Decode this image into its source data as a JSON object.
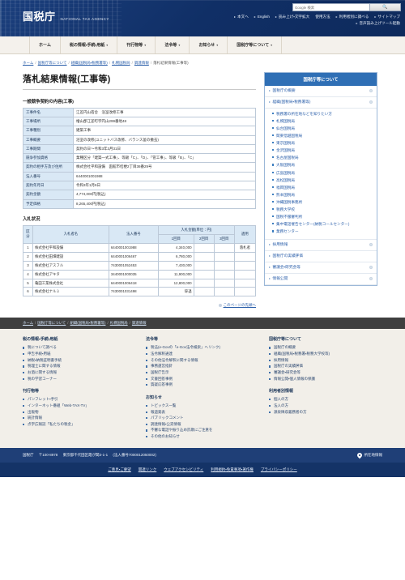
{
  "header": {
    "logo_jp": "国税庁",
    "logo_en": "NATIONAL TAX AGENCY",
    "search_placeholder": "Google 検索",
    "search_button_icon": "search-icon",
    "util_links": [
      "本文へ",
      "English",
      "読み上げ・文字拡大",
      "使用方法",
      "利用者別に調べる",
      "サイトマップ"
    ],
    "util_links_row2": [
      "音声読み上げツール起動"
    ]
  },
  "gnav": [
    {
      "label": "ホーム",
      "caret": ""
    },
    {
      "label": "税の情報・手続・用紙",
      "caret": "▾"
    },
    {
      "label": "刊行物等",
      "caret": "▾"
    },
    {
      "label": "法令等",
      "caret": "▾"
    },
    {
      "label": "お知らせ",
      "caret": "▾"
    },
    {
      "label": "国税庁等について",
      "caret": "▾"
    }
  ],
  "breadcrumb": [
    "ホーム",
    "国税庁等について",
    "組織(国税局・税務署等)",
    "札幌国税局",
    "調達情報",
    "落札結果情報(工事等)"
  ],
  "main": {
    "page_title": "落札結果情報(工事等)",
    "section1_title": "一般競争契約の内容(工事)",
    "detail_rows": [
      {
        "label": "工事件名",
        "value": "江差円山宿舎　浴室改修工事"
      },
      {
        "label": "工事場所",
        "value": "檜山郡江差町字円山299番地48"
      },
      {
        "label": "工事種別",
        "value": "建築工事"
      },
      {
        "label": "工事概要",
        "value": "浴室の改修(ユニットバス改修、バランス釜の撤去)"
      },
      {
        "label": "工事期間",
        "value": "契約の日～令和3年3月31日"
      },
      {
        "label": "競争参加資格",
        "value": "業種区分「建築一式工事」、等級「C」、「D」、「管工事」、等級「B」、「C」"
      },
      {
        "label": "契約の相手方及び住所",
        "value": "株式会社平和設備　函館市桔梗2丁目36番29号"
      },
      {
        "label": "法人番号",
        "value": "6440001001988"
      },
      {
        "label": "契約年月日",
        "value": "令和3年1月6日"
      },
      {
        "label": "契約金額",
        "value": "4,774,000円(税込)"
      },
      {
        "label": "予定価格",
        "value": "8,265,400円(税込)"
      }
    ],
    "section2_title": "入札状況",
    "bid_headers": {
      "kubun": "区分",
      "bidder": "入札者名",
      "hojin": "法人番号",
      "amount_group": "入札金額(単位：円)",
      "round1": "1回目",
      "round2": "2回目",
      "round3": "3回目",
      "note": "適用"
    },
    "bid_rows": [
      {
        "no": "1",
        "name": "株式会社平和設備",
        "hojin": "6440001001988",
        "r1": "4,340,000",
        "r2": "",
        "r3": "",
        "note": "落札者"
      },
      {
        "no": "2",
        "name": "株式会社田畑建設",
        "hojin": "6440001006467",
        "r1": "6,780,000",
        "r2": "",
        "r3": "",
        "note": ""
      },
      {
        "no": "3",
        "name": "株式会社アスフル",
        "hojin": "7430001052453",
        "r1": "7,430,000",
        "r2": "",
        "r3": "",
        "note": ""
      },
      {
        "no": "4",
        "name": "株式会社アキタ",
        "hojin": "3440001000035",
        "r1": "11,900,000",
        "r2": "",
        "r3": "",
        "note": ""
      },
      {
        "no": "5",
        "name": "亀田工業株式会社",
        "hojin": "6440001006418",
        "r1": "12,800,000",
        "r2": "",
        "r3": "",
        "note": ""
      },
      {
        "no": "6",
        "name": "株式会社ナルミ",
        "hojin": "7430001031498",
        "r1": "辞退",
        "r2": "",
        "r3": "",
        "note": ""
      }
    ],
    "page_top_link": "このページの先頭へ"
  },
  "sidebar": {
    "title": "国税庁等について",
    "link1": "国税庁の概要",
    "link2": "組織(国税局・税務署等)",
    "bureaus": [
      "税務署の所在地などを知りたい方",
      "札幌国税局",
      "仙台国税局",
      "関東信越国税局",
      "東京国税局",
      "金沢国税局",
      "名古屋国税局",
      "大阪国税局",
      "広島国税局",
      "高松国税局",
      "福岡国税局",
      "熊本国税局",
      "沖縄国税事務所",
      "税務大学校",
      "国税不服審判所",
      "集中電話催告センター(納税コールセンター)",
      "業務センター"
    ],
    "links_after": [
      "採用情報",
      "国税庁の実績評価",
      "審議会・研究会等",
      "情報公開"
    ]
  },
  "footer": {
    "breadcrumb": [
      "ホーム",
      "国税庁等について",
      "組織(国税局・税務署等)",
      "札幌国税局",
      "調達情報"
    ],
    "columns": [
      {
        "groups": [
          {
            "heading": "税の情報・手続・用紙",
            "items": [
              "税について調べる",
              "申告手続・用紙",
              "納税・納税証明書手続",
              "税理士に関する情報",
              "お酒に関する情報",
              "税の学習コーナー"
            ]
          },
          {
            "heading": "刊行物等",
            "items": [
              "パンフレット・手引",
              "インターネット番組「Web-TAX-TV」",
              "出版物",
              "統計情報",
              "点字広報誌「私たちの税金」"
            ]
          }
        ]
      },
      {
        "groups": [
          {
            "heading": "法令等",
            "items": [
              "税法(e-Govの「e-Gov法令検索」へリンク)",
              "法令解釈通達",
              "その他法令解釈に関する情報",
              "事務運営指針",
              "国税庁告示",
              "文書回答事例",
              "質疑応答事例"
            ]
          },
          {
            "heading": "お知らせ",
            "items": [
              "トピックス一覧",
              "報道発表",
              "パブリックコメント",
              "調達情報・公売情報",
              "不審な電話や振り込め詐欺にご注意を",
              "その他のお知らせ"
            ]
          }
        ]
      },
      {
        "groups": [
          {
            "heading": "国税庁等について",
            "items": [
              "国税庁の概要",
              "組織(国税局・税務署・税務大学校等)",
              "採用情報",
              "国税庁の実績評価",
              "審議会・研究会等",
              "情報公開・個人情報の保護"
            ]
          },
          {
            "heading": "利用者別情報",
            "items": [
              "個人の方",
              "法人の方",
              "源泉徴収義務者の方"
            ]
          }
        ]
      }
    ],
    "agency": "国税庁",
    "zip": "〒100-8978",
    "address": "東京都千代田区霞が関3-1-1",
    "corp_number": "(法人番号7000012050002)",
    "location_link": "所在地情報",
    "bottom_links": [
      "ご意見・ご要望",
      "関連リンク",
      "ウェブアクセシビリティ",
      "利用規約・免責事項・著作権",
      "プライバシーポリシー"
    ]
  },
  "colors": {
    "header_blue": "#123772",
    "accent_blue": "#2f6fb5",
    "table_header": "#d9e8f5",
    "footer_bg": "#f2efe9",
    "footer_dark": "#143367"
  }
}
